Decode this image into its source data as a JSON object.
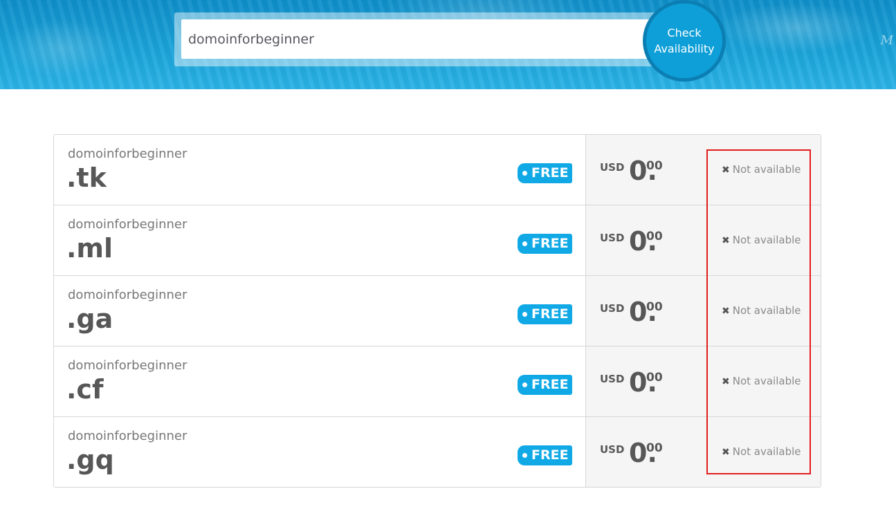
{
  "search": {
    "value": "domoinforbeginner",
    "button_label_line1": "Check",
    "button_label_line2": "Availability"
  },
  "hero": {
    "decor_text": "M"
  },
  "results": [
    {
      "sld": "domoinforbeginner",
      "tld": ".tk",
      "badge": "FREE",
      "currency": "USD",
      "price_int": "0.",
      "price_dec": "00",
      "status": "Not available"
    },
    {
      "sld": "domoinforbeginner",
      "tld": ".ml",
      "badge": "FREE",
      "currency": "USD",
      "price_int": "0.",
      "price_dec": "00",
      "status": "Not available"
    },
    {
      "sld": "domoinforbeginner",
      "tld": ".ga",
      "badge": "FREE",
      "currency": "USD",
      "price_int": "0.",
      "price_dec": "00",
      "status": "Not available"
    },
    {
      "sld": "domoinforbeginner",
      "tld": ".cf",
      "badge": "FREE",
      "currency": "USD",
      "price_int": "0.",
      "price_dec": "00",
      "status": "Not available"
    },
    {
      "sld": "domoinforbeginner",
      "tld": ".gq",
      "badge": "FREE",
      "currency": "USD",
      "price_int": "0.",
      "price_dec": "00",
      "status": "Not available"
    }
  ],
  "colors": {
    "accent": "#10a9e6",
    "highlight": "#e21b1b"
  },
  "icons": {
    "status_icon": "close-icon"
  }
}
